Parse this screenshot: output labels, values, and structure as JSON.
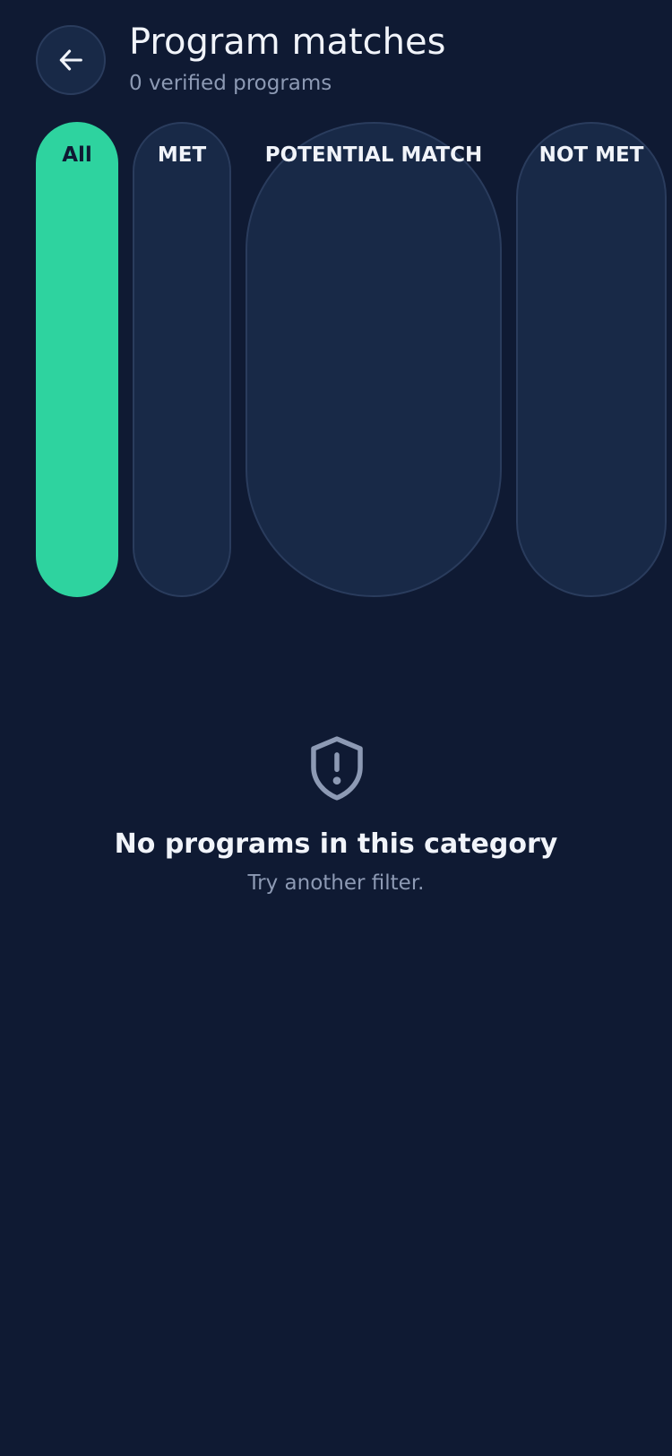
{
  "header": {
    "title": "Program matches",
    "subtitle": "0 verified programs",
    "back_icon": "arrow-left-icon"
  },
  "filters": [
    {
      "label": "All",
      "active": true
    },
    {
      "label": "MET",
      "active": false
    },
    {
      "label": "POTENTIAL MATCH",
      "active": false
    },
    {
      "label": "NOT MET",
      "active": false
    }
  ],
  "empty_state": {
    "icon": "shield-alert-icon",
    "title": "No programs in this category",
    "subtitle": "Try another filter."
  },
  "colors": {
    "background": "#0f1a33",
    "chip_active": "#2ed39f",
    "chip_inactive": "#182947",
    "text_primary": "#f1f4fa",
    "text_muted": "#8d9ab4"
  }
}
